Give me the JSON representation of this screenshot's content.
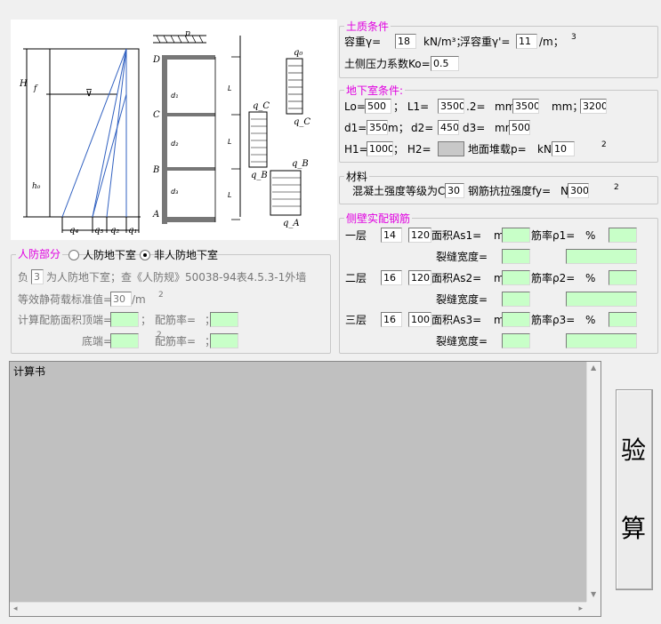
{
  "diagram": {
    "labels": {
      "H": "H",
      "f": "f",
      "hs": "h₀",
      "p": "p",
      "qD": "q₀",
      "qC": "q_C",
      "qB": "q_B",
      "qA": "q_A",
      "D": "D",
      "C": "C",
      "B": "B",
      "A": "A",
      "d1": "d₁",
      "d2": "d₂",
      "d3": "d₃",
      "q4": "q₄",
      "q3": "q₃",
      "q2": "q₂",
      "q1": "q₁",
      "L": "L"
    }
  },
  "soil": {
    "title": "土质条件",
    "gamma_label": "容重γ=",
    "gamma_value": "18",
    "gamma_unit": "kN/m³；",
    "gamma2_label": "浮容重γ'=",
    "gamma2_value": "11",
    "gamma2_unit": "/m；",
    "sup3": "3",
    "k0_label": "土侧压力系数Ko=",
    "k0_value": "0.5"
  },
  "basement": {
    "title": "地下室条件:",
    "lo_label": "Lo=",
    "lo_value": "500",
    "l1_label": "；  L1=",
    "l1_value": "3500",
    "l2_label": ".2=",
    "l2_unit": "mm",
    "l2_value": "3500",
    "l3_unit": "mm；",
    "l3_value": "3200",
    "d1_label": "d1=",
    "d1_value": "350",
    "d1_unit": "m；",
    "d2_label": "d2=",
    "d2_value": "450",
    "d3_label": "d3=",
    "d3_unit": "mm",
    "d3_value": "500",
    "h1_label": "H1=",
    "h1_value": "1000",
    "h2_label": "；  H2=",
    "load_label": "地面堆载p=",
    "load_unit": "kN",
    "load_value": "10",
    "sup2": "2"
  },
  "material": {
    "title": "材料",
    "concrete_label": "混凝土强度等级为C",
    "concrete_value": "30",
    "steel_label": "钢筋抗拉强度fy=",
    "steel_unit": "N",
    "steel_value": "300",
    "sup2": "2"
  },
  "rebar": {
    "title": "侧壁实配钢筋",
    "rows": [
      {
        "floor": "一层",
        "dia": "14",
        "spacing": "120",
        "area_label": "面积As1=",
        "area_unit": "m",
        "ratio_label": "筋率ρ1=",
        "pct": "%",
        "crack_label": "裂缝宽度="
      },
      {
        "floor": "二层",
        "dia": "16",
        "spacing": "120",
        "area_label": "面积As2=",
        "area_unit": "m",
        "ratio_label": "筋率ρ2=",
        "pct": "%",
        "crack_label": "裂缝宽度="
      },
      {
        "floor": "三层",
        "dia": "16",
        "spacing": "100",
        "area_label": "面积As3=",
        "area_unit": "m",
        "ratio_label": "筋率ρ3=",
        "pct": "%",
        "crack_label": "裂缝宽度="
      }
    ]
  },
  "civil": {
    "title": "人防部分",
    "opt1": "人防地下室",
    "opt2": "非人防地下室",
    "selected": "非人防地下室",
    "neg_label": "负",
    "neg_value": "3",
    "neg_text": "为人防地下室；查《人防规》50038-94表4.5.3-1外墙",
    "static_label": "等效静荷载标准值=",
    "static_value": "30",
    "static_unit": "/m",
    "sup2": "2",
    "area_top_label": "计算配筋面积顶端=",
    "area_unit": "；",
    "ratio_label": "配筋率=",
    "pct": "；",
    "area_bottom_label": "底端=",
    "ratio2_label": "配筋率=",
    "pct2": "；",
    "sup2b": "2"
  },
  "report": {
    "title": "计算书"
  },
  "button": {
    "char1": "验",
    "char2": "算"
  }
}
